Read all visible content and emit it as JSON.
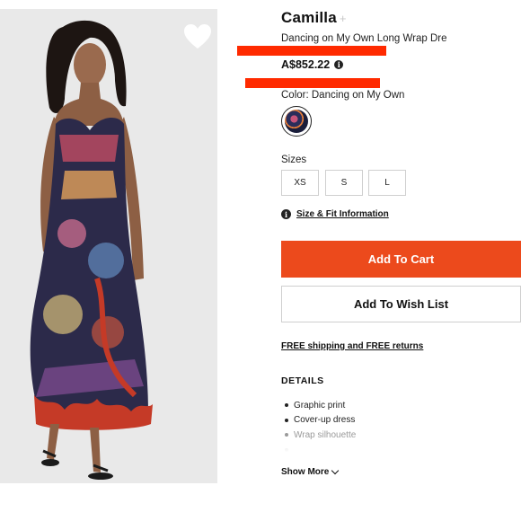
{
  "product": {
    "brand": "Camilla",
    "brand_suffix": "+",
    "name": "Dancing on My Own Long Wrap Dre",
    "price": "A$852.22",
    "price_info_icon": "info-icon",
    "color_label": "Color: Dancing on My Own",
    "sizes_label": "Sizes",
    "sizes": [
      "XS",
      "S",
      "L"
    ],
    "size_fit_link": "Size & Fit Information",
    "wishlist_icon": "heart-icon"
  },
  "actions": {
    "add_to_cart": "Add To Cart",
    "add_to_wish_list": "Add To Wish List"
  },
  "shipping": "FREE shipping and FREE returns",
  "details": {
    "title": "DETAILS",
    "items": [
      "Graphic print",
      "Cover-up dress",
      "Wrap silhouette",
      ""
    ],
    "show_more": "Show More"
  },
  "colors": {
    "add_to_cart_bg": "#ec4a1c",
    "redaction_bar": "#ff2a00"
  }
}
